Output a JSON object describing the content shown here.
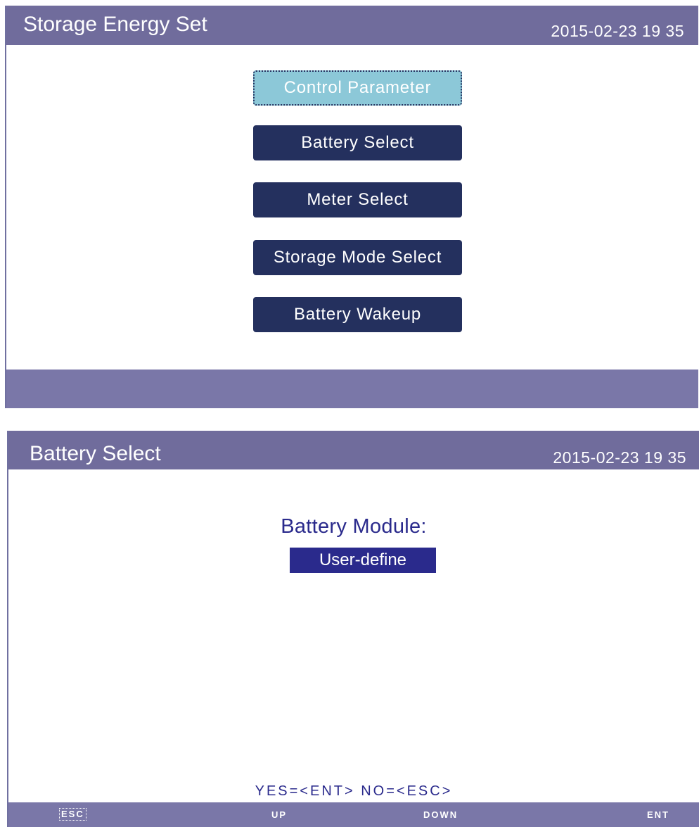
{
  "screen1": {
    "title": "Storage Energy Set",
    "datetime": "2015-02-23   19 35",
    "menu": [
      {
        "label": "Control Parameter",
        "selected": true
      },
      {
        "label": "Battery Select",
        "selected": false
      },
      {
        "label": "Meter Select",
        "selected": false
      },
      {
        "label": "Storage Mode Select",
        "selected": false
      },
      {
        "label": "Battery Wakeup",
        "selected": false
      }
    ]
  },
  "screen2": {
    "title": "Battery Select",
    "datetime": "2015-02-23   19 35",
    "module_label": "Battery Module:",
    "module_value": "User-define",
    "hint": "YES=<ENT>  NO=<ESC>",
    "footer_keys": {
      "esc": "ESC",
      "up": "UP",
      "down": "DOWN",
      "ent": "ENT"
    }
  },
  "colors": {
    "titlebar": "#706c9c",
    "button": "#24305e",
    "selected_button": "#8cc8d8",
    "text_accent": "#2a2a8c"
  }
}
